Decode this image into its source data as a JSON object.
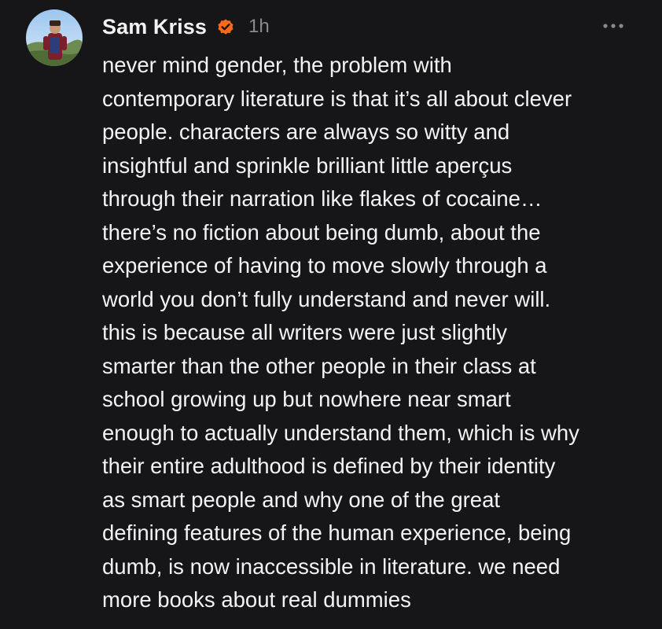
{
  "post": {
    "author": "Sam Kriss",
    "badge_icon": "verified-check-icon",
    "badge_color": "#ff6a1a",
    "timestamp": "1h",
    "more_icon": "more-horizontal-icon",
    "body": "never mind gender, the problem with\ncontemporary literature is that it’s all about clever\npeople. characters are always so witty and\ninsightful and sprinkle brilliant little aperçus\nthrough their narration like flakes of cocaine…\nthere’s no fiction about being dumb, about the\nexperience of having to move slowly through a\nworld you don’t fully understand and never will.\nthis is because all writers were just slightly\nsmarter than the other people in their class at\nschool growing up but nowhere near smart\nenough to actually understand them, which is why\ntheir entire adulthood is defined by their identity\nas smart people and why one of the great\ndefining features of the human experience, being\ndumb, is now inaccessible in literature. we need\nmore books about real dummies"
  },
  "colors": {
    "background": "#161618",
    "text": "#f3f3f3",
    "muted": "#8a8a8e"
  }
}
